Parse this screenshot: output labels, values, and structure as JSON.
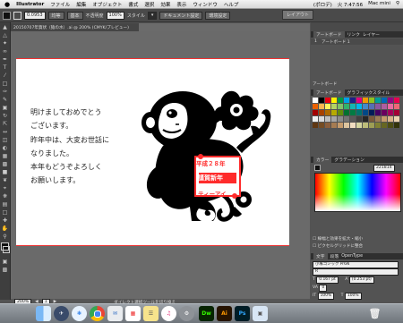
{
  "menubar": {
    "apple": "",
    "app": "Illustrator",
    "items": [
      "ファイル",
      "編集",
      "オブジェクト",
      "書式",
      "選択",
      "効果",
      "表示",
      "ウィンドウ",
      "ヘルプ"
    ],
    "battery": "(ポロデ)",
    "time": "火 7:47:56",
    "user": "Mac mini"
  },
  "control": {
    "opacity_label": "不透明度",
    "opacity_value": "100%",
    "style_label": "スタイル",
    "doc_setup": "ドキュメント設定",
    "env_setup": "環境設定",
    "stroke_value": "0.0953",
    "stroke_style": "均等",
    "basic": "基本"
  },
  "workspace": "レイアウト",
  "document": {
    "tab": "20150707年賀状（猿の水）.ai @ 200% (CMYK/プレビュー)"
  },
  "greeting": {
    "lines": [
      "明けましておめでとう",
      "ございます。",
      "昨年中は、大変お世話に",
      "なりました。",
      "本年もどうぞよろしく",
      "お願いします。"
    ]
  },
  "stamp": {
    "line1": "平成２８年",
    "line2": "謹賀新年",
    "line3": "ティーアイ"
  },
  "status": {
    "zoom": "200%",
    "page": "1",
    "tool": "ダイレクト選択ツールを切り換え"
  },
  "panels": {
    "artboard_tabs": [
      "アートボード",
      "リンク",
      "レイヤー"
    ],
    "artboard_row_num": "1",
    "artboard_row_name": "アートボード 1",
    "artboard_footer": "アートボード",
    "swatch_tabs": [
      "アートボード",
      "グラフィックスタイル"
    ],
    "color_tabs": [
      "カラー",
      "グラデーション"
    ],
    "color_hex": "221814",
    "checkbox1": "線幅と効果を拡大・縮小",
    "checkbox2": "ピクセルグリッドに整合",
    "char_tabs": [
      "文字",
      "段落",
      "OpenType"
    ],
    "font_name": "小塚ゴシック Pr6N",
    "font_style": "R",
    "font_size": "0.167 pt",
    "leading": "(0.253 pt)",
    "tracking": "0",
    "scale_v": "100%",
    "scale_h": "100%"
  },
  "dock": {
    "icons": [
      "finder-icon",
      "launchpad-icon",
      "safari-icon",
      "chrome-icon",
      "mail-icon",
      "calendar-icon",
      "notes-icon",
      "itunes-icon",
      "system-preferences-icon",
      "dreamweaver-icon",
      "illustrator-icon",
      "photoshop-icon",
      "preview-icon",
      "trash-icon"
    ],
    "dw": "Dw",
    "ai": "Ai",
    "ps": "Ps"
  }
}
